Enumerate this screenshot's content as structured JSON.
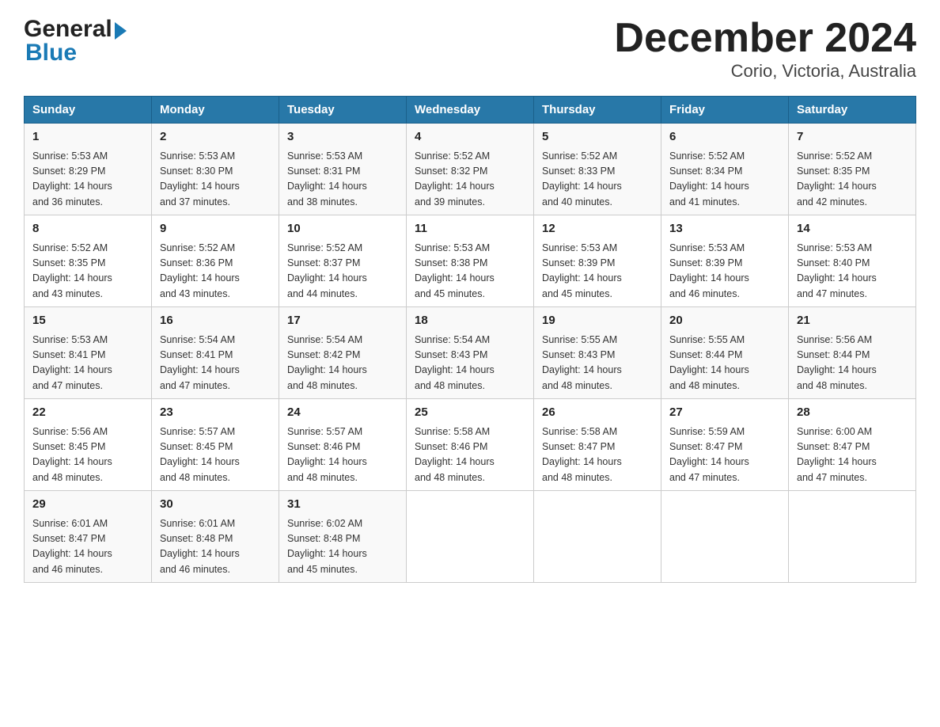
{
  "logo": {
    "general": "General",
    "blue": "Blue"
  },
  "title": "December 2024",
  "subtitle": "Corio, Victoria, Australia",
  "weekdays": [
    "Sunday",
    "Monday",
    "Tuesday",
    "Wednesday",
    "Thursday",
    "Friday",
    "Saturday"
  ],
  "weeks": [
    [
      {
        "day": "1",
        "sunrise": "5:53 AM",
        "sunset": "8:29 PM",
        "daylight": "14 hours and 36 minutes."
      },
      {
        "day": "2",
        "sunrise": "5:53 AM",
        "sunset": "8:30 PM",
        "daylight": "14 hours and 37 minutes."
      },
      {
        "day": "3",
        "sunrise": "5:53 AM",
        "sunset": "8:31 PM",
        "daylight": "14 hours and 38 minutes."
      },
      {
        "day": "4",
        "sunrise": "5:52 AM",
        "sunset": "8:32 PM",
        "daylight": "14 hours and 39 minutes."
      },
      {
        "day": "5",
        "sunrise": "5:52 AM",
        "sunset": "8:33 PM",
        "daylight": "14 hours and 40 minutes."
      },
      {
        "day": "6",
        "sunrise": "5:52 AM",
        "sunset": "8:34 PM",
        "daylight": "14 hours and 41 minutes."
      },
      {
        "day": "7",
        "sunrise": "5:52 AM",
        "sunset": "8:35 PM",
        "daylight": "14 hours and 42 minutes."
      }
    ],
    [
      {
        "day": "8",
        "sunrise": "5:52 AM",
        "sunset": "8:35 PM",
        "daylight": "14 hours and 43 minutes."
      },
      {
        "day": "9",
        "sunrise": "5:52 AM",
        "sunset": "8:36 PM",
        "daylight": "14 hours and 43 minutes."
      },
      {
        "day": "10",
        "sunrise": "5:52 AM",
        "sunset": "8:37 PM",
        "daylight": "14 hours and 44 minutes."
      },
      {
        "day": "11",
        "sunrise": "5:53 AM",
        "sunset": "8:38 PM",
        "daylight": "14 hours and 45 minutes."
      },
      {
        "day": "12",
        "sunrise": "5:53 AM",
        "sunset": "8:39 PM",
        "daylight": "14 hours and 45 minutes."
      },
      {
        "day": "13",
        "sunrise": "5:53 AM",
        "sunset": "8:39 PM",
        "daylight": "14 hours and 46 minutes."
      },
      {
        "day": "14",
        "sunrise": "5:53 AM",
        "sunset": "8:40 PM",
        "daylight": "14 hours and 47 minutes."
      }
    ],
    [
      {
        "day": "15",
        "sunrise": "5:53 AM",
        "sunset": "8:41 PM",
        "daylight": "14 hours and 47 minutes."
      },
      {
        "day": "16",
        "sunrise": "5:54 AM",
        "sunset": "8:41 PM",
        "daylight": "14 hours and 47 minutes."
      },
      {
        "day": "17",
        "sunrise": "5:54 AM",
        "sunset": "8:42 PM",
        "daylight": "14 hours and 48 minutes."
      },
      {
        "day": "18",
        "sunrise": "5:54 AM",
        "sunset": "8:43 PM",
        "daylight": "14 hours and 48 minutes."
      },
      {
        "day": "19",
        "sunrise": "5:55 AM",
        "sunset": "8:43 PM",
        "daylight": "14 hours and 48 minutes."
      },
      {
        "day": "20",
        "sunrise": "5:55 AM",
        "sunset": "8:44 PM",
        "daylight": "14 hours and 48 minutes."
      },
      {
        "day": "21",
        "sunrise": "5:56 AM",
        "sunset": "8:44 PM",
        "daylight": "14 hours and 48 minutes."
      }
    ],
    [
      {
        "day": "22",
        "sunrise": "5:56 AM",
        "sunset": "8:45 PM",
        "daylight": "14 hours and 48 minutes."
      },
      {
        "day": "23",
        "sunrise": "5:57 AM",
        "sunset": "8:45 PM",
        "daylight": "14 hours and 48 minutes."
      },
      {
        "day": "24",
        "sunrise": "5:57 AM",
        "sunset": "8:46 PM",
        "daylight": "14 hours and 48 minutes."
      },
      {
        "day": "25",
        "sunrise": "5:58 AM",
        "sunset": "8:46 PM",
        "daylight": "14 hours and 48 minutes."
      },
      {
        "day": "26",
        "sunrise": "5:58 AM",
        "sunset": "8:47 PM",
        "daylight": "14 hours and 48 minutes."
      },
      {
        "day": "27",
        "sunrise": "5:59 AM",
        "sunset": "8:47 PM",
        "daylight": "14 hours and 47 minutes."
      },
      {
        "day": "28",
        "sunrise": "6:00 AM",
        "sunset": "8:47 PM",
        "daylight": "14 hours and 47 minutes."
      }
    ],
    [
      {
        "day": "29",
        "sunrise": "6:01 AM",
        "sunset": "8:47 PM",
        "daylight": "14 hours and 46 minutes."
      },
      {
        "day": "30",
        "sunrise": "6:01 AM",
        "sunset": "8:48 PM",
        "daylight": "14 hours and 46 minutes."
      },
      {
        "day": "31",
        "sunrise": "6:02 AM",
        "sunset": "8:48 PM",
        "daylight": "14 hours and 45 minutes."
      },
      null,
      null,
      null,
      null
    ]
  ],
  "labels": {
    "sunrise": "Sunrise:",
    "sunset": "Sunset:",
    "daylight": "Daylight:"
  }
}
